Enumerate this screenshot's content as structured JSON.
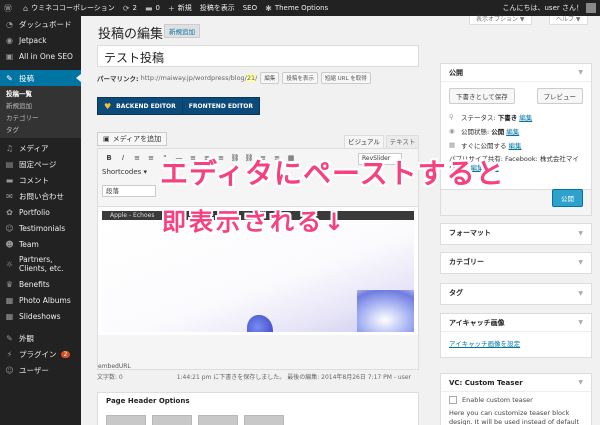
{
  "adminbar": {
    "site_name": "ウミネココーポレーション",
    "updates": "2",
    "comments": "0",
    "new_label": "新規",
    "view_post": "投稿を表示",
    "seo": "SEO",
    "theme_options": "Theme Options",
    "greeting": "こんにちは、user さん！"
  },
  "screen_options": {
    "display": "表示オプション ▼",
    "help": "ヘルプ ▼"
  },
  "sidebar": {
    "items": [
      {
        "label": "ダッシュボード",
        "icon": "dashboard-icon"
      },
      {
        "label": "Jetpack",
        "icon": "jetpack-icon"
      },
      {
        "label": "All in One SEO",
        "icon": "seo-icon"
      },
      {
        "label": "投稿",
        "icon": "pin-icon"
      },
      {
        "label": "メディア",
        "icon": "media-icon"
      },
      {
        "label": "固定ページ",
        "icon": "page-icon"
      },
      {
        "label": "コメント",
        "icon": "comment-icon"
      },
      {
        "label": "お問い合わせ",
        "icon": "mail-icon"
      },
      {
        "label": "Portfolio",
        "icon": "portfolio-icon"
      },
      {
        "label": "Testimonials",
        "icon": "testimonials-icon"
      },
      {
        "label": "Team",
        "icon": "team-icon"
      },
      {
        "label": "Partners, Clients, etc.",
        "icon": "partners-icon"
      },
      {
        "label": "Benefits",
        "icon": "benefits-icon"
      },
      {
        "label": "Photo Albums",
        "icon": "photo-icon"
      },
      {
        "label": "Slideshows",
        "icon": "slideshow-icon"
      },
      {
        "label": "外観",
        "icon": "appearance-icon"
      },
      {
        "label": "プラグイン",
        "icon": "plugin-icon",
        "badge": "2"
      },
      {
        "label": "ユーザー",
        "icon": "user-icon"
      }
    ],
    "submenu": [
      "投稿一覧",
      "新規追加",
      "カテゴリー",
      "タグ"
    ]
  },
  "page": {
    "title": "投稿の編集",
    "add_new": "新規追加",
    "post_title": "テスト投稿",
    "permalink_label": "パーマリンク:",
    "permalink_base": "http://maiway.jp/wordpress/blog/",
    "permalink_slug": "21",
    "permalink_end": "/",
    "permalink_buttons": [
      "編集",
      "投稿を表示",
      "短縮 URL を取得"
    ],
    "backend_editor": "BACKEND EDITOR",
    "frontend_editor": "FRONTEND EDITOR"
  },
  "editor": {
    "add_media": "メディアを追加",
    "tab_visual": "ビジュアル",
    "tab_text": "テキスト",
    "toolbar": [
      "B",
      "I",
      "≡",
      "≡",
      "“",
      "—",
      "≡",
      "≡",
      "≡",
      "⛓",
      "⛓",
      "≡",
      "≡",
      "▦"
    ],
    "revslider": "RevSlider",
    "shortcodes": "Shortcodes ▾",
    "format": "段落",
    "pasted_caption": "Apple - Echoes",
    "embed_url": "embedURL",
    "word_count": "文字数: 0",
    "autosave": "1:44:21 pm に下書きを保存しました。 最後の編集: 2014年8月26日 7:17 PM - user"
  },
  "page_header": {
    "title": "Page Header Options"
  },
  "publish": {
    "title": "公開",
    "save_draft": "下書きとして保存",
    "preview": "プレビュー",
    "status_label": "ステータス:",
    "status_value": "下書き",
    "visibility_label": "公開状態:",
    "visibility_value": "公開",
    "schedule_label": "すぐに公開する",
    "edit": "編集",
    "share_text": "パブリサイズ共有: Facebook: 株式会社マイウェイ",
    "settings": "設定",
    "publish_btn": "公開"
  },
  "boxes": {
    "format": "フォーマット",
    "category": "カテゴリー",
    "tags": "タグ",
    "thumbnail": "アイキャッチ画像",
    "thumbnail_link": "アイキャッチ画像を設定",
    "vc_title": "VC: Custom Teaser",
    "vc_enable": "Enable custom teaser",
    "vc_desc": "Here you can customize teaser block design. It will be used instead of default settings in \"Posts Grid\" or \"Carousel\""
  },
  "annotation": {
    "line1": "エディタにペーストすると",
    "line2": "即表示される↓"
  },
  "colors": {
    "admin_dark": "#222222",
    "accent": "#0074a2",
    "annotation": "#f64080",
    "vc_editor": "#0c4a7a"
  }
}
